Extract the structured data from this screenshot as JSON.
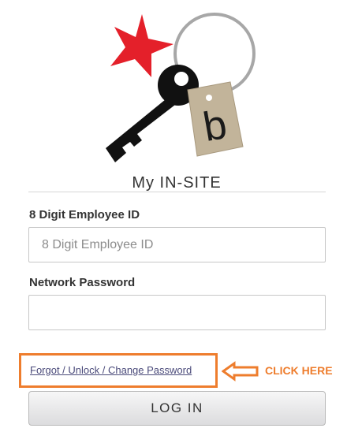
{
  "app": {
    "title": "My IN-SITE"
  },
  "logo": {
    "letter": "b",
    "icons": [
      "star-icon",
      "key-ring-icon",
      "key-icon",
      "key-tag-icon"
    ],
    "colors": {
      "star": "#e4202a",
      "key": "#111111",
      "ring": "#a7a7a7",
      "tag": "#c2b49a"
    }
  },
  "form": {
    "employee_id_label": "8 Digit Employee ID",
    "employee_id_placeholder": "8 Digit Employee ID",
    "employee_id_value": "",
    "password_label": "Network Password",
    "password_value": "",
    "forgot_link": "Forgot / Unlock / Change Password",
    "login_button": "LOG IN"
  },
  "annotation": {
    "text": "CLICK HERE",
    "color": "#ee7d2d",
    "icon": "arrow-left-icon"
  }
}
